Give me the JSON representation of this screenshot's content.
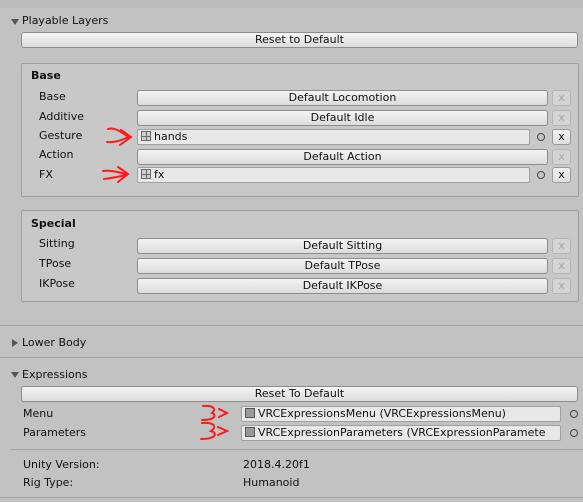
{
  "playable_layers": {
    "title": "Playable Layers",
    "reset_label": "Reset to Default",
    "base": {
      "heading": "Base",
      "rows": [
        {
          "label": "Base",
          "value": "Default Locomotion"
        },
        {
          "label": "Additive",
          "value": "Default Idle"
        },
        {
          "label": "Gesture",
          "value": "hands"
        },
        {
          "label": "Action",
          "value": "Default Action"
        },
        {
          "label": "FX",
          "value": "fx"
        }
      ]
    },
    "special": {
      "heading": "Special",
      "rows": [
        {
          "label": "Sitting",
          "value": "Default Sitting"
        },
        {
          "label": "TPose",
          "value": "Default TPose"
        },
        {
          "label": "IKPose",
          "value": "Default IKPose"
        }
      ]
    },
    "x_label": "x"
  },
  "lower_body": {
    "title": "Lower Body"
  },
  "expressions": {
    "title": "Expressions",
    "reset_label": "Reset To Default",
    "menu_label": "Menu",
    "menu_value": "VRCExpressionsMenu (VRCExpressionsMenu)",
    "parameters_label": "Parameters",
    "parameters_value": "VRCExpressionParameters (VRCExpressionParamete"
  },
  "info": {
    "unity_label": "Unity Version:",
    "unity_value": "2018.4.20f1",
    "rig_label": "Rig Type:",
    "rig_value": "Humanoid"
  },
  "colors": {
    "annotation": "#ff1a1a",
    "background": "#c2c2c2",
    "panel": "#c8c8c8"
  }
}
